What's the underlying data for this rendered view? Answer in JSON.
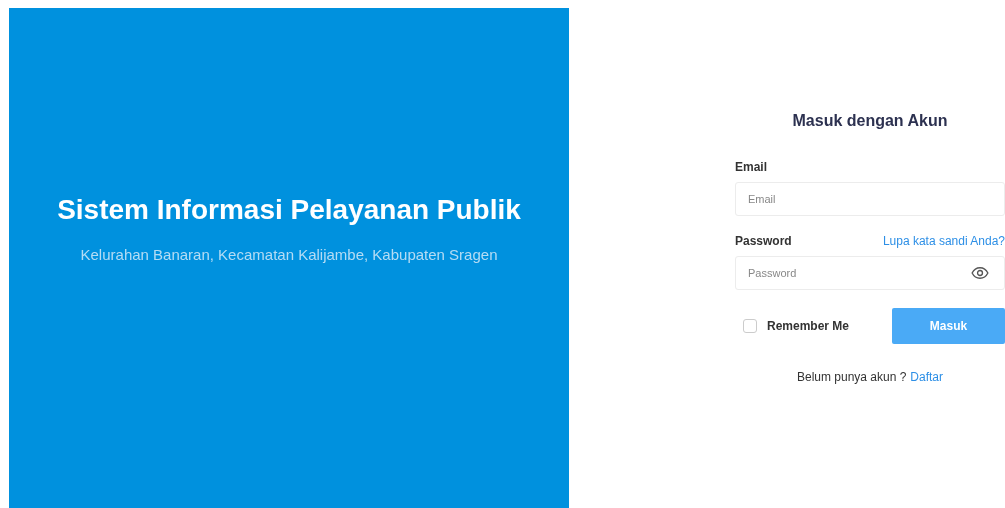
{
  "hero": {
    "title": "Sistem Informasi Pelayanan Publik",
    "subtitle": "Kelurahan Banaran, Kecamatan Kalijambe, Kabupaten Sragen"
  },
  "form": {
    "title": "Masuk dengan Akun",
    "email": {
      "label": "Email",
      "placeholder": "Email"
    },
    "password": {
      "label": "Password",
      "placeholder": "Password",
      "forgot_link": "Lupa kata sandi Anda?"
    },
    "remember": {
      "label": "Remember Me",
      "checked": false
    },
    "submit": "Masuk",
    "register": {
      "text": "Belum punya akun ?",
      "link": "Daftar"
    }
  }
}
